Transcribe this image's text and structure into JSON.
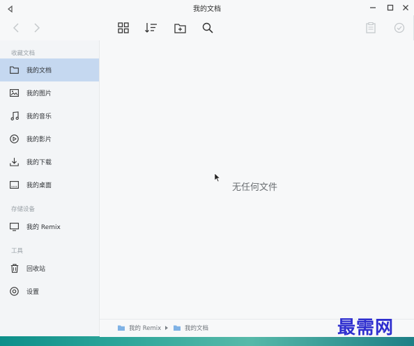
{
  "window": {
    "title": "我的文档"
  },
  "sidebar": {
    "sections": [
      {
        "label": "收藏文档"
      },
      {
        "label": "存储设备"
      },
      {
        "label": "工具"
      }
    ],
    "items": [
      {
        "label": "我的文档",
        "icon": "folder-icon",
        "active": true
      },
      {
        "label": "我的图片",
        "icon": "image-icon"
      },
      {
        "label": "我的音乐",
        "icon": "music-icon"
      },
      {
        "label": "我的影片",
        "icon": "video-icon"
      },
      {
        "label": "我的下载",
        "icon": "download-icon"
      },
      {
        "label": "我的桌面",
        "icon": "desktop-icon"
      },
      {
        "label": "我的 Remix",
        "icon": "monitor-icon"
      },
      {
        "label": "回收站",
        "icon": "trash-icon"
      },
      {
        "label": "设置",
        "icon": "settings-icon"
      }
    ]
  },
  "main": {
    "empty_text": "无任何文件"
  },
  "breadcrumb": {
    "items": [
      "我的 Remix",
      "我的文档"
    ]
  },
  "watermark": "最需网",
  "colors": {
    "active_bg": "#c5d8f0",
    "accent": "#4a90d9"
  }
}
